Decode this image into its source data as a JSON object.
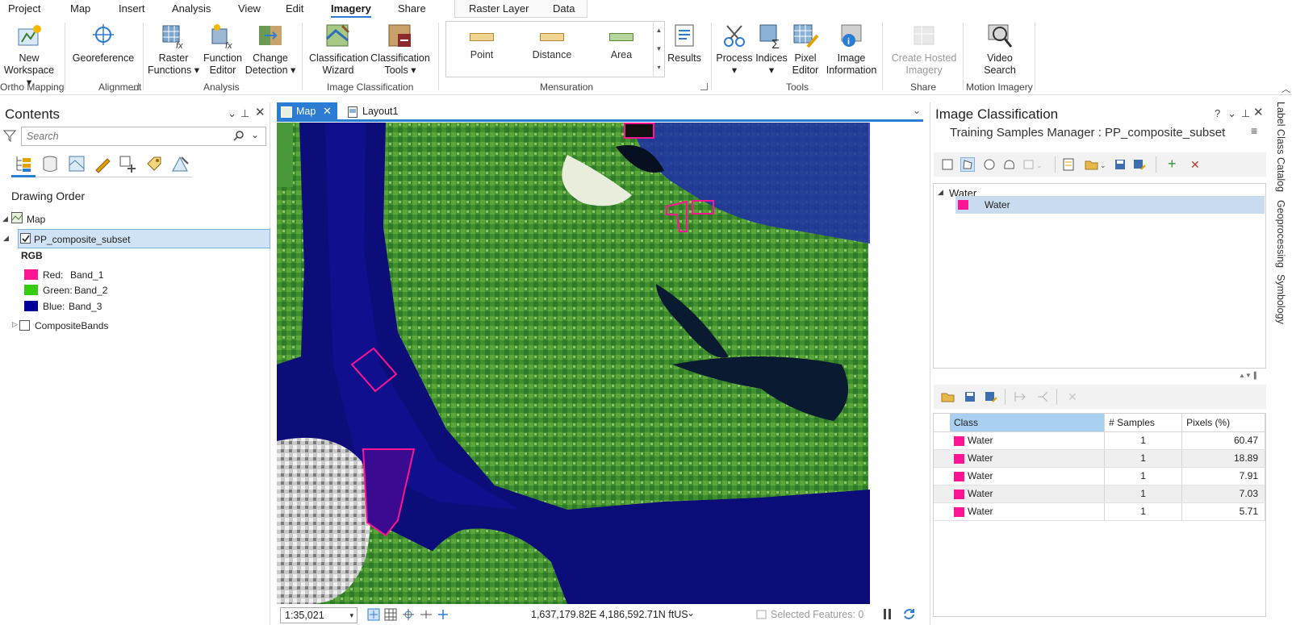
{
  "menu": {
    "tabs": [
      "Project",
      "Map",
      "Insert",
      "Analysis",
      "View",
      "Edit",
      "Imagery",
      "Share"
    ],
    "active": "Imagery",
    "contextual_tabs": [
      "Raster Layer",
      "Data"
    ]
  },
  "ribbon": {
    "new_workspace": "New Workspace",
    "georeference": "Georeference",
    "raster_functions": "Raster Functions",
    "function_editor": "Function Editor",
    "change_detection": "Change Detection",
    "classification_wizard": "Classification Wizard",
    "classification_tools": "Classification Tools",
    "point": "Point",
    "distance": "Distance",
    "area": "Area",
    "results": "Results",
    "process": "Process",
    "indices": "Indices",
    "pixel_editor": "Pixel Editor",
    "image_information": "Image Information",
    "create_hosted_imagery": "Create Hosted Imagery",
    "video_search": "Video Search",
    "groups": {
      "ortho_mapping": "Ortho Mapping",
      "alignment": "Alignment",
      "analysis": "Analysis",
      "image_classification": "Image Classification",
      "mensuration": "Mensuration",
      "tools": "Tools",
      "share": "Share",
      "motion_imagery": "Motion Imagery"
    }
  },
  "contents": {
    "title": "Contents",
    "search_placeholder": "Search",
    "drawing_order": "Drawing Order",
    "map_label": "Map",
    "layer_name": "PP_composite_subset",
    "renderer": "RGB",
    "bands": [
      {
        "label": "Red:",
        "band": "Band_1",
        "color": "#ff1493"
      },
      {
        "label": "Green:",
        "band": "Band_2",
        "color": "#33cc11"
      },
      {
        "label": "Blue:",
        "band": "Band_3",
        "color": "#000099"
      }
    ],
    "other_layer": "CompositeBands"
  },
  "view": {
    "tabs": [
      "Map",
      "Layout1"
    ],
    "scale": "1:35,021",
    "coordinates": "1,637,179.82E 4,186,592.71N ftUS",
    "selected_features": "Selected Features: 0"
  },
  "image_classification": {
    "title": "Image Classification",
    "subtitle": "Training Samples Manager : PP_composite_subset",
    "schema_parent": "Water",
    "schema_child": "Water",
    "table": {
      "headers": [
        "Class",
        "# Samples",
        "Pixels (%)"
      ],
      "rows": [
        {
          "class": "Water",
          "samples": "1",
          "pixels": "60.47"
        },
        {
          "class": "Water",
          "samples": "1",
          "pixels": "18.89"
        },
        {
          "class": "Water",
          "samples": "1",
          "pixels": "7.91"
        },
        {
          "class": "Water",
          "samples": "1",
          "pixels": "7.03"
        },
        {
          "class": "Water",
          "samples": "1",
          "pixels": "5.71"
        }
      ]
    },
    "class_color": "#ff1493"
  },
  "side_tabs": [
    "Label Class",
    "Catalog",
    "Geoprocessing",
    "Symbology"
  ]
}
